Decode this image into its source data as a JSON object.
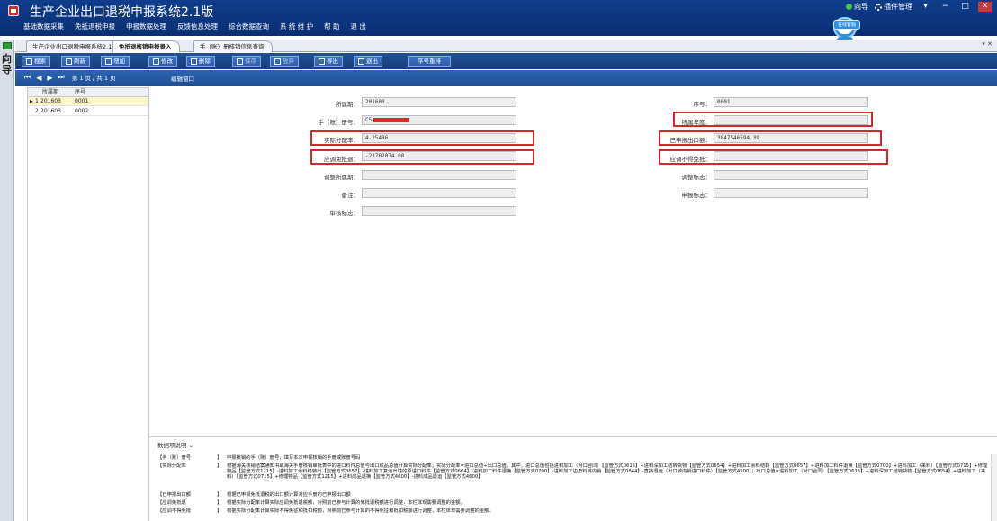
{
  "app": {
    "title": "生产企业出口退税申报系统2.1版"
  },
  "main_menu": [
    "基础数据采集",
    "免抵退税申报",
    "申报数据处理",
    "反馈信息处理",
    "综合数据查询",
    "系 统 维 护",
    "帮 助",
    "退 出"
  ],
  "top_right": {
    "guide": "向导",
    "plugin": "插件管理",
    "online_badge": "在线客服",
    "mascot_label": "ROOT"
  },
  "window_buttons": {
    "min": "−",
    "max": "□",
    "close": "✕",
    "menu": "▾"
  },
  "nav_strip": {
    "text": "向导"
  },
  "tabs": [
    {
      "label": "生产企业出口退税申报系统2.1版",
      "active": false
    },
    {
      "label": "免抵退核销申报录入",
      "active": true
    },
    {
      "label": "手（账）册核销信息查询",
      "active": false
    }
  ],
  "tab_close": "▾ ✕",
  "toolbar": {
    "search": "搜索",
    "refresh": "刷新",
    "add": "增加",
    "edit": "修改",
    "delete": "删除",
    "save": "保存",
    "discard": "放弃",
    "export": "导出",
    "exit": "退出",
    "reorder": "序号重排"
  },
  "record_nav": {
    "first": "⏮",
    "prev": "◀",
    "next": "▶",
    "last": "⏭",
    "page_info": "第 1 页 / 共 1 页",
    "edit_caption": "编辑窗口"
  },
  "grid": {
    "headers": [
      "所属期",
      "序号"
    ],
    "rows": [
      {
        "num": "1",
        "period": "201603",
        "seq": "0001",
        "selected": true
      },
      {
        "num": "2",
        "period": "201603",
        "seq": "0002",
        "selected": false
      }
    ]
  },
  "form": {
    "period_label": "所属期：",
    "period_value": "201603",
    "seq_label": "序号：",
    "seq_value": "0001",
    "manual_label": "手（账）册号：",
    "manual_value": "C5",
    "year_label": "所属年度：",
    "year_value": "",
    "ratio_label": "实际分配率：",
    "ratio_value": "4.25486",
    "declared_label": "已申报出口额：",
    "declared_value": "3847546594.39",
    "exempt_label": "应调免抵退：",
    "exempt_value": "-21702074.08",
    "nonexempt_label": "应调不得免抵：",
    "nonexempt_value": "",
    "adj_period_label": "调整所属期：",
    "adj_period_value": "",
    "adj_flag_label": "调整标志：",
    "adj_flag_value": "",
    "remark_label": "备注：",
    "remark_value": "",
    "decl_flag_label": "申报标志：",
    "decl_flag_value": "",
    "audit_label": "审核标志：",
    "audit_value": ""
  },
  "explain": {
    "title": "数据项说明",
    "rows": [
      {
        "label": "【手（账）册号",
        "text": "申报核销的手（账）册号，填写本次申报核销的手册或账册号码"
      },
      {
        "label": "【实际分配率",
        "text": "根据海关核销结案通知书或海关手册核销审批表中的进口料件总值与出口成品总值计算实际分配率；实际分配率=进口总值÷出口总值。其中，进口总值包括进料加工（对口合同）【监管方式0615】+进料深加工结转货物【监管方式0654】+进料加工余料结转【监管方式0657】+进料加工料件退换【监管方式0700】+进料加工（来料）【监管方式0715】+修理物品【监管方式1215】-进料加工余料结转出【监管方式0657】-进料加工复运出境的原进口料件【监管方式0664】-进料加工料件退换【监管方式0700】-进料加工边角料转内销【监管方式0844】-直接退运（出口转内销进口料件）【监管方式4500】；出口总值=进料加工（对口合同）【监管方式0615】+进料深加工结转货物【监管方式0654】+进料加工（来料）【监管方式0715】+修理物品【监管方式1215】+进料成品退换【监管方式4600】-进料成品退运【监管方式4600】"
      },
      {
        "label": "【已申报出口额",
        "text": "根据已申报免抵退税的出口额计算对应手册的已申报出口额"
      },
      {
        "label": "【应调免抵退",
        "text": "根据实际分配率计算实际应调免抵退税额，对照前已参与计算的免抵退税额进行调整，本栏体现需要调整的金额。"
      },
      {
        "label": "【应调不得免抵",
        "text": "根据实际分配率计算实际不得免征和抵扣税额，对照前已参与计算的不得免征和抵扣税额进行调整，本栏体现需要调整的金额。"
      }
    ],
    "bracket": "】"
  }
}
